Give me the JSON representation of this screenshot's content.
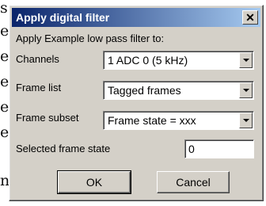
{
  "background_text": {
    "letters": [
      "s",
      "e",
      "e",
      "e",
      "e",
      "e",
      "n"
    ]
  },
  "dialog": {
    "title": "Apply digital filter",
    "close_label": "✕",
    "intro": "Apply Example low pass filter to:",
    "channels": {
      "label": "Channels",
      "value": "1 ADC 0 (5 kHz)"
    },
    "frame_list": {
      "label": "Frame list",
      "value": "Tagged frames"
    },
    "frame_subset": {
      "label": "Frame subset",
      "value": "Frame state = xxx"
    },
    "selected_state": {
      "label": "Selected frame state",
      "value": "0"
    },
    "ok_label": "OK",
    "cancel_label": "Cancel"
  },
  "colors": {
    "dialog_face": "#d4d0c8",
    "title_start": "#0a246a",
    "title_end": "#a6caf0"
  }
}
